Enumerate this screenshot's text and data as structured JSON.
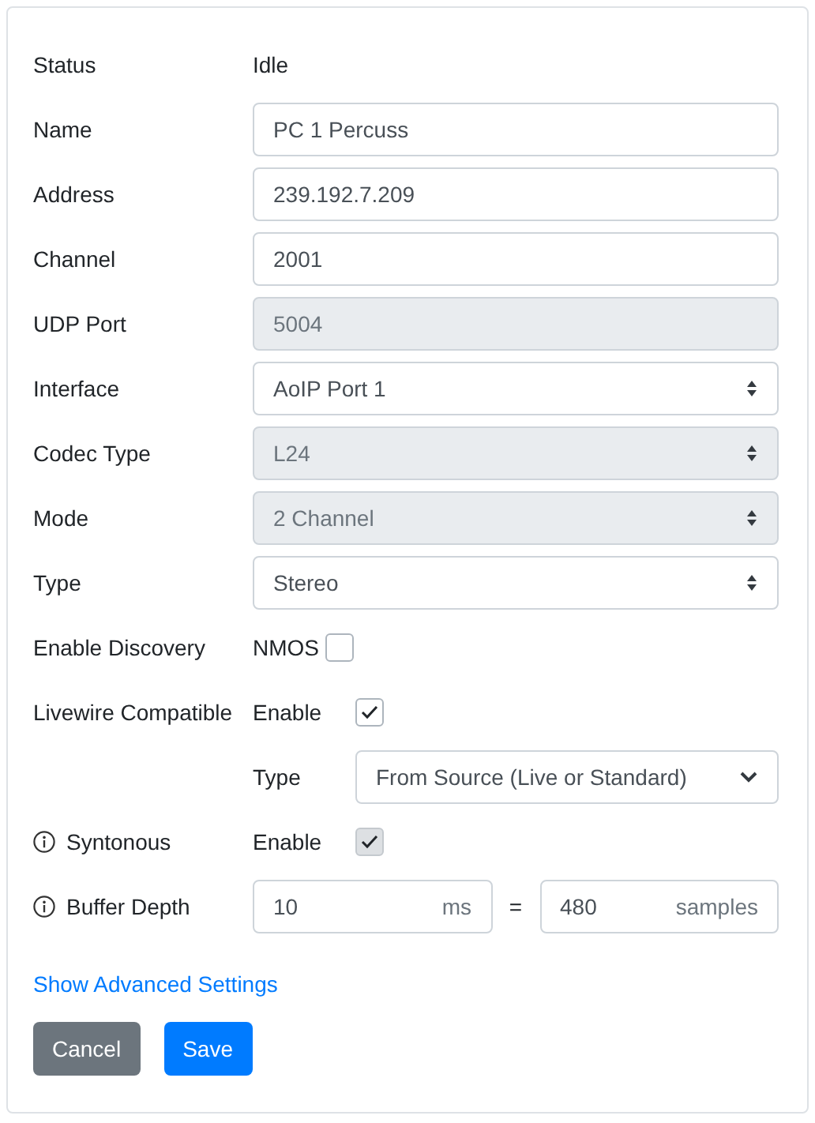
{
  "rows": [
    {
      "kind": "static",
      "label": "Status",
      "value": "Idle"
    },
    {
      "kind": "input",
      "label": "Name",
      "value": "PC 1 Percuss",
      "disabled": false
    },
    {
      "kind": "input",
      "label": "Address",
      "value": "239.192.7.209",
      "disabled": false
    },
    {
      "kind": "input",
      "label": "Channel",
      "value": "2001",
      "disabled": false
    },
    {
      "kind": "input",
      "label": "UDP Port",
      "value": "5004",
      "disabled": true
    },
    {
      "kind": "select",
      "label": "Interface",
      "value": "AoIP Port 1",
      "disabled": false
    },
    {
      "kind": "select",
      "label": "Codec Type",
      "value": "L24",
      "disabled": true
    },
    {
      "kind": "select",
      "label": "Mode",
      "value": "2 Channel",
      "disabled": true
    },
    {
      "kind": "select",
      "label": "Type",
      "value": "Stereo",
      "disabled": false
    },
    {
      "kind": "check-inline",
      "label": "Enable Discovery",
      "option": "NMOS",
      "checked": false,
      "disabled": false
    },
    {
      "kind": "checkbox",
      "label": "Livewire Compatible",
      "option": "Enable",
      "checked": true,
      "disabled": false
    },
    {
      "kind": "dropdown",
      "option": "Type",
      "value": "From Source (Live or Standard)"
    },
    {
      "kind": "checkbox",
      "label": "Syntonous",
      "info": true,
      "option": "Enable",
      "checked": true,
      "disabled": true
    },
    {
      "kind": "buffer",
      "label": "Buffer Depth",
      "info": true,
      "value": "10",
      "unit": "ms",
      "equals": "=",
      "value2": "480",
      "unit2": "samples"
    }
  ],
  "link": "Show Advanced Settings",
  "buttons": [
    {
      "label": "Cancel",
      "kind": "secondary"
    },
    {
      "label": "Save",
      "kind": "primary"
    }
  ]
}
